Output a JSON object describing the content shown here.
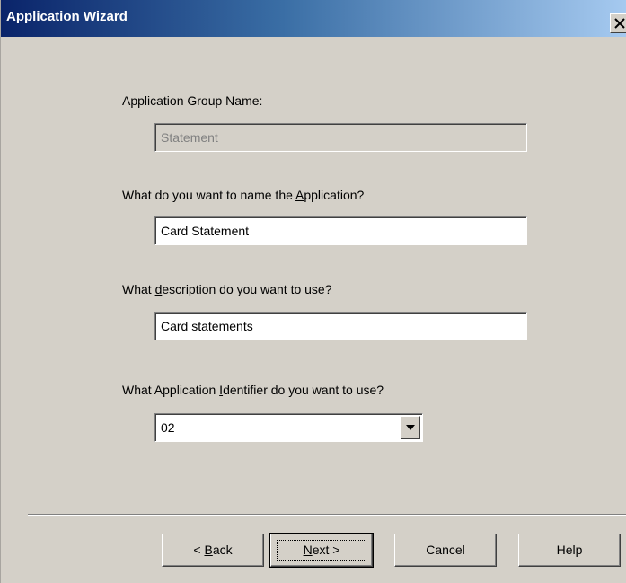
{
  "window": {
    "title": "Application Wizard",
    "close_icon": "close-x-icon"
  },
  "form": {
    "group_name": {
      "label": "Application Group Name:",
      "value": "Statement"
    },
    "app_name": {
      "label_pre": "What do you want to name the ",
      "label_accel": "A",
      "label_post": "pplication?",
      "value": "Card Statement"
    },
    "description": {
      "label_pre": "What ",
      "label_accel": "d",
      "label_post": "escription do you want to use?",
      "value": "Card statements"
    },
    "identifier": {
      "label_pre": "What Application ",
      "label_accel": "I",
      "label_post": "dentifier do you want to use?",
      "value": "02",
      "dropdown_icon": "chevron-down-icon"
    }
  },
  "buttons": {
    "back": {
      "pre": "< ",
      "accel": "B",
      "post": "ack"
    },
    "next": {
      "pre": "",
      "accel": "N",
      "post": "ext >"
    },
    "cancel": "Cancel",
    "help": "Help"
  }
}
